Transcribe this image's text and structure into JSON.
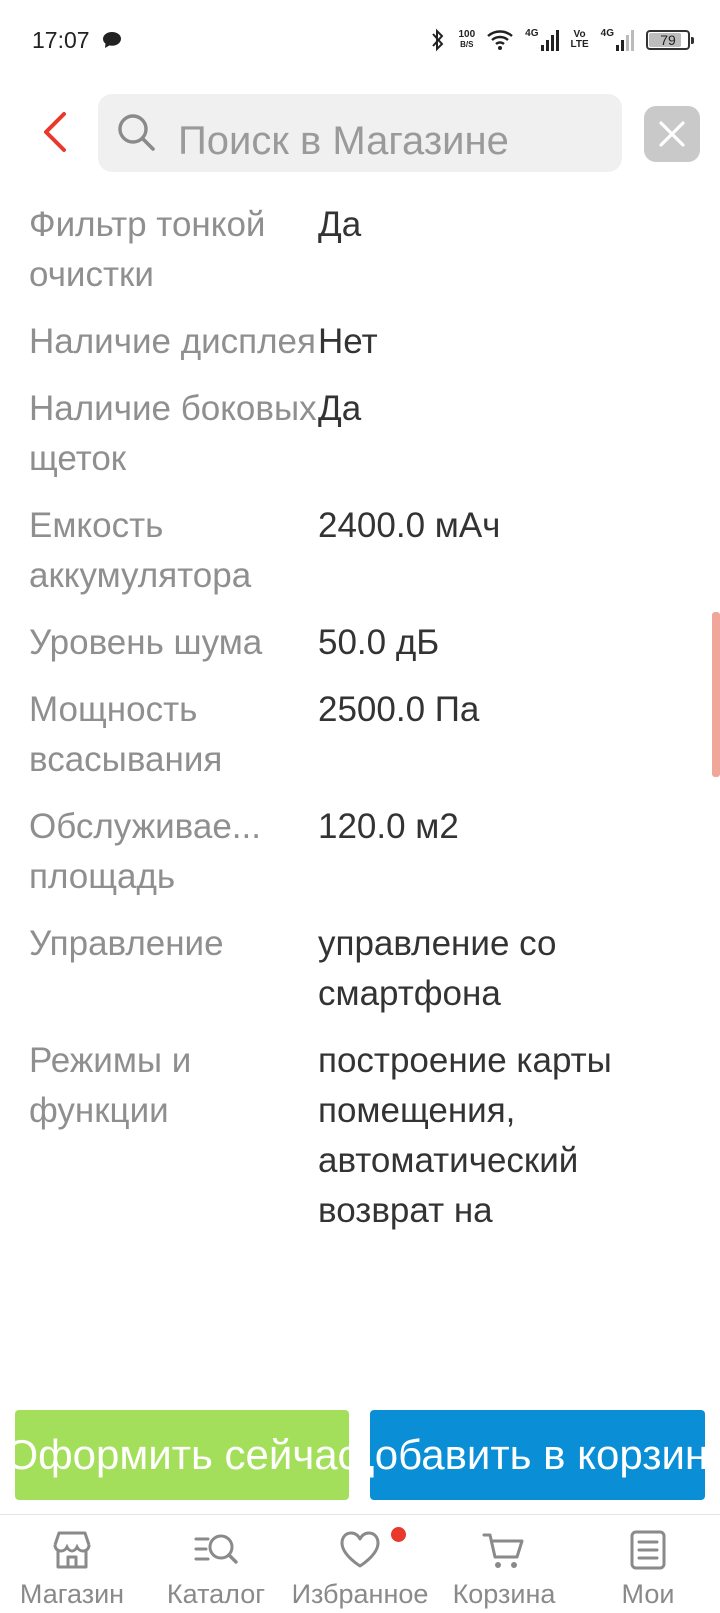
{
  "status_bar": {
    "time": "17:07",
    "net_speed_top": "100",
    "net_speed_bottom": "B/S",
    "net1": "4G",
    "volte_top": "Vo",
    "volte_bottom": "LTE",
    "net2": "4G",
    "battery": "79"
  },
  "header": {
    "search_placeholder": "Поиск в Магазине"
  },
  "specs": [
    {
      "label": "Фильтр тонкой очистки",
      "value": "Да"
    },
    {
      "label": "Наличие дисплея",
      "value": "Нет"
    },
    {
      "label": "Наличие боковых щеток",
      "value": "Да"
    },
    {
      "label": "Емкость аккумулятора",
      "value": "2400.0 мАч"
    },
    {
      "label": "Уровень шума",
      "value": "50.0 дБ"
    },
    {
      "label": "Мощность всасывания",
      "value": "2500.0 Па"
    },
    {
      "label_line1": "Обслуживае...",
      "label_line2": "площадь",
      "value": "120.0 м2"
    },
    {
      "label": "Управление",
      "value": "управление со смартфона"
    },
    {
      "label": "Режимы и функции",
      "value": "построение карты помещения, автоматический возврат на"
    }
  ],
  "actions": {
    "buy_now": "Оформить сейчас",
    "add_to_cart": "Добавить в корзину"
  },
  "nav": {
    "items": [
      {
        "label": "Магазин"
      },
      {
        "label": "Каталог"
      },
      {
        "label": "Избранное"
      },
      {
        "label": "Корзина"
      },
      {
        "label": "Мои"
      }
    ]
  },
  "colors": {
    "accent_red": "#e8392c",
    "buy_green": "#a4df5b",
    "cart_blue": "#0a8fd6"
  }
}
